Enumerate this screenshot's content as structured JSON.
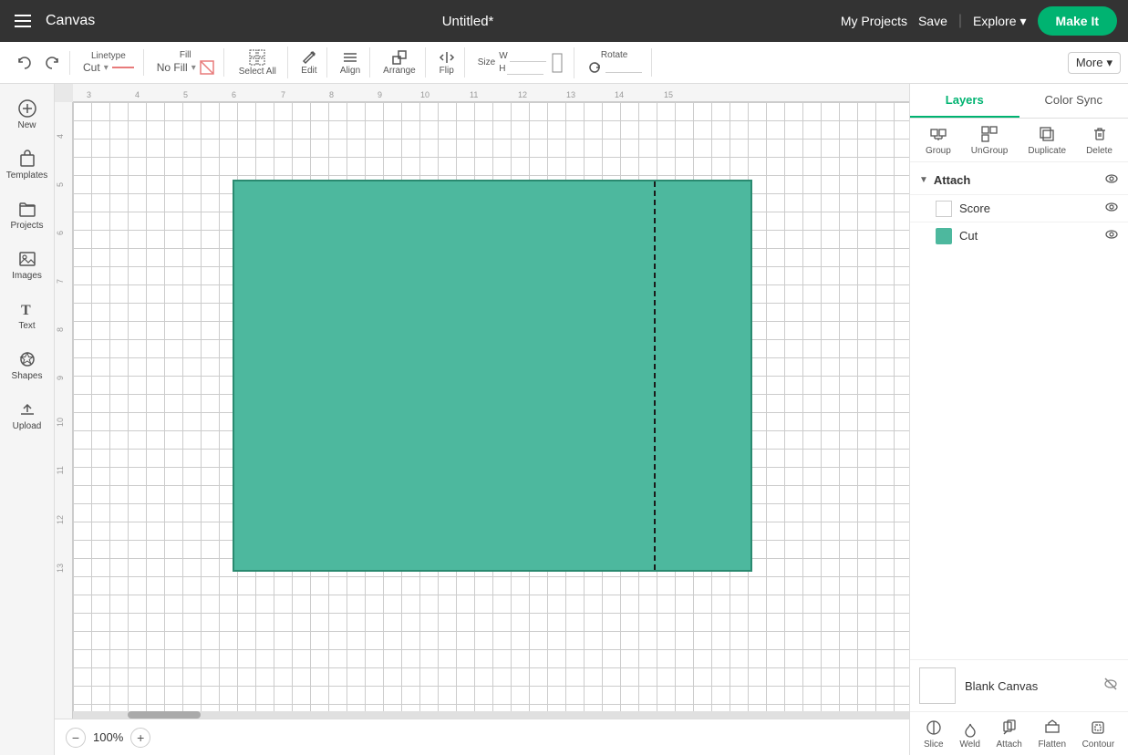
{
  "topNav": {
    "title": "Canvas",
    "pageTitle": "Untitled*",
    "myProjectsLabel": "My Projects",
    "saveLabel": "Save",
    "exploreLabel": "Explore",
    "makeItLabel": "Make It"
  },
  "toolbar": {
    "linetypeLabel": "Linetype",
    "linetypeValue": "Cut",
    "fillLabel": "Fill",
    "fillValue": "No Fill",
    "selectAllLabel": "Select All",
    "editLabel": "Edit",
    "alignLabel": "Align",
    "arrangeLabel": "Arrange",
    "flipLabel": "Flip",
    "sizeLabel": "Size",
    "wLabel": "W",
    "hLabel": "H",
    "rotateLabel": "Rotate",
    "moreLabel": "More"
  },
  "sidebar": {
    "items": [
      {
        "id": "new",
        "label": "New",
        "icon": "➕"
      },
      {
        "id": "templates",
        "label": "Templates",
        "icon": "👕"
      },
      {
        "id": "projects",
        "label": "Projects",
        "icon": "📁"
      },
      {
        "id": "images",
        "label": "Images",
        "icon": "🖼"
      },
      {
        "id": "text",
        "label": "Text",
        "icon": "T"
      },
      {
        "id": "shapes",
        "label": "Shapes",
        "icon": "⬡"
      },
      {
        "id": "upload",
        "label": "Upload",
        "icon": "⬆"
      }
    ]
  },
  "rightPanel": {
    "tabs": [
      {
        "id": "layers",
        "label": "Layers",
        "active": true
      },
      {
        "id": "colorSync",
        "label": "Color Sync",
        "active": false
      }
    ],
    "toolbarItems": [
      {
        "id": "group",
        "label": "Group",
        "disabled": false
      },
      {
        "id": "ungroup",
        "label": "UnGroup",
        "disabled": false
      },
      {
        "id": "duplicate",
        "label": "Duplicate",
        "disabled": false
      },
      {
        "id": "delete",
        "label": "Delete",
        "disabled": false
      }
    ],
    "layers": {
      "groupName": "Attach",
      "children": [
        {
          "id": "score",
          "name": "Score",
          "color": null,
          "visible": true
        },
        {
          "id": "cut",
          "name": "Cut",
          "color": "#4db89e",
          "visible": true
        }
      ]
    },
    "blankCanvas": {
      "label": "Blank Canvas"
    },
    "bottomTools": [
      {
        "id": "slice",
        "label": "Slice"
      },
      {
        "id": "weld",
        "label": "Weld"
      },
      {
        "id": "attach",
        "label": "Attach"
      },
      {
        "id": "flatten",
        "label": "Flatten"
      },
      {
        "id": "contour",
        "label": "Contour"
      }
    ]
  },
  "canvas": {
    "zoom": "100%",
    "rulerMarks": [
      "3",
      "4",
      "5",
      "6",
      "7",
      "8",
      "9",
      "10",
      "11",
      "12",
      "13",
      "14",
      "15"
    ],
    "leftMarks": [
      "4",
      "5",
      "6",
      "7",
      "8",
      "9",
      "10",
      "11",
      "12",
      "13"
    ]
  }
}
